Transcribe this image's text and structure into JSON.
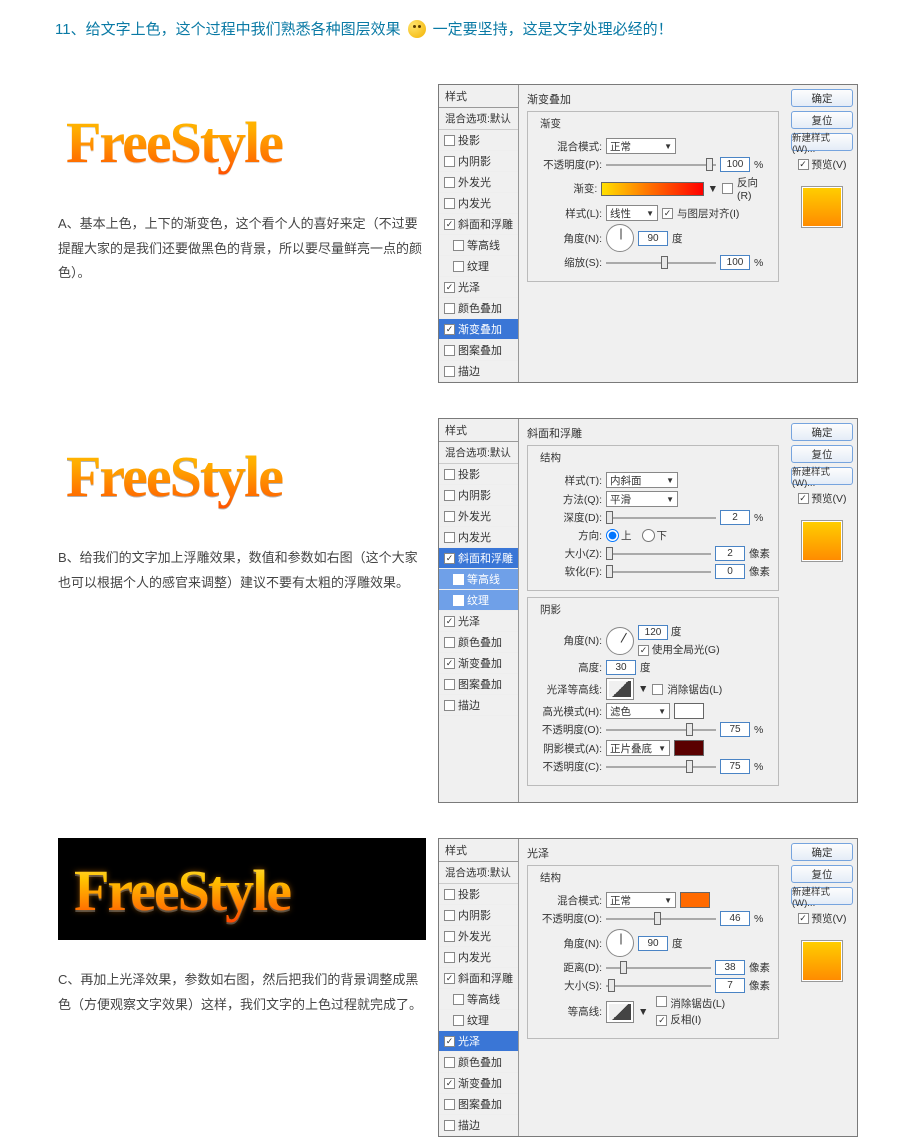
{
  "headline": {
    "pre": "11、给文字上色，这个过程中我们熟悉各种图层效果",
    "post": "一定要坚持，这是文字处理必经的！"
  },
  "logo_text": "FreeStyle",
  "captions": {
    "a": "A、基本上色，上下的渐变色，这个看个人的喜好来定（不过要提醒大家的是我们还要做黑色的背景，所以要尽量鲜亮一点的颜色）。",
    "b": "B、给我们的文字加上浮雕效果，数值和参数如右图（这个大家也可以根据个人的感官来调整）建议不要有太粗的浮雕效果。",
    "c": "C、再加上光泽效果，参数如右图，然后把我们的背景调整成黑色（方便观察文字效果）这样，我们文字的上色过程就完成了。"
  },
  "style_list": {
    "hdr": "样式",
    "sub": "混合选项:默认",
    "items": [
      {
        "label": "投影",
        "on": false
      },
      {
        "label": "内阴影",
        "on": false
      },
      {
        "label": "外发光",
        "on": false
      },
      {
        "label": "内发光",
        "on": false
      },
      {
        "label": "斜面和浮雕",
        "on": true
      },
      {
        "label": "等高线",
        "on": false,
        "indent": true
      },
      {
        "label": "纹理",
        "on": false,
        "indent": true
      },
      {
        "label": "光泽",
        "on": true
      },
      {
        "label": "颜色叠加",
        "on": false
      },
      {
        "label": "渐变叠加",
        "on": true
      },
      {
        "label": "图案叠加",
        "on": false
      },
      {
        "label": "描边",
        "on": false
      }
    ]
  },
  "right": {
    "ok": "确定",
    "cancel": "复位",
    "new": "新建样式(W)...",
    "preview": "预览(V)"
  },
  "panelA": {
    "title": "渐变叠加",
    "group": "渐变",
    "labels": {
      "blend": "混合模式:",
      "opacity": "不透明度(P):",
      "gradient": "渐变:",
      "style": "样式(L):",
      "angle": "角度(N):",
      "scale": "缩放(S):",
      "reverse": "反向(R)",
      "align": "与图层对齐(I)"
    },
    "values": {
      "blend": "正常",
      "opacity": "100",
      "style": "线性",
      "angle": "90",
      "deg": "度",
      "scale": "100",
      "pct": "%"
    }
  },
  "panelB": {
    "title": "斜面和浮雕",
    "struct": "结构",
    "labels": {
      "style": "样式(T):",
      "tech": "方法(Q):",
      "depth": "深度(D):",
      "dir": "方向:",
      "up": "上",
      "down": "下",
      "size": "大小(Z):",
      "soften": "软化(F):",
      "px": "像素",
      "pct": "%"
    },
    "vals": {
      "style": "内斜面",
      "tech": "平滑",
      "depth": "2",
      "size": "2",
      "soften": "0"
    },
    "shadow_title": "阴影",
    "shadow": {
      "angle_l": "角度(N):",
      "angle": "120",
      "deg": "度",
      "use_global": "使用全局光(G)",
      "alt_l": "高度:",
      "alt": "30",
      "gloss_l": "光泽等高线:",
      "anti": "消除锯齿(L)",
      "hi_mode_l": "高光模式(H):",
      "hi_mode": "滤色",
      "hi_op": "75",
      "sh_mode_l": "阴影模式(A):",
      "sh_mode": "正片叠底",
      "sh_op": "75",
      "op_l": "不透明度(O):",
      "op2_l": "不透明度(C):"
    }
  },
  "panelC": {
    "title": "光泽",
    "group": "结构",
    "labels": {
      "blend": "混合模式:",
      "opacity": "不透明度(O):",
      "angle": "角度(N):",
      "dist": "距离(D):",
      "size": "大小(S):",
      "contour": "等高线:",
      "anti": "消除锯齿(L)",
      "invert": "反相(I)",
      "deg": "度",
      "px": "像素",
      "pct": "%"
    },
    "vals": {
      "blend": "正常",
      "opacity": "46",
      "angle": "90",
      "dist": "38",
      "size": "7"
    }
  }
}
